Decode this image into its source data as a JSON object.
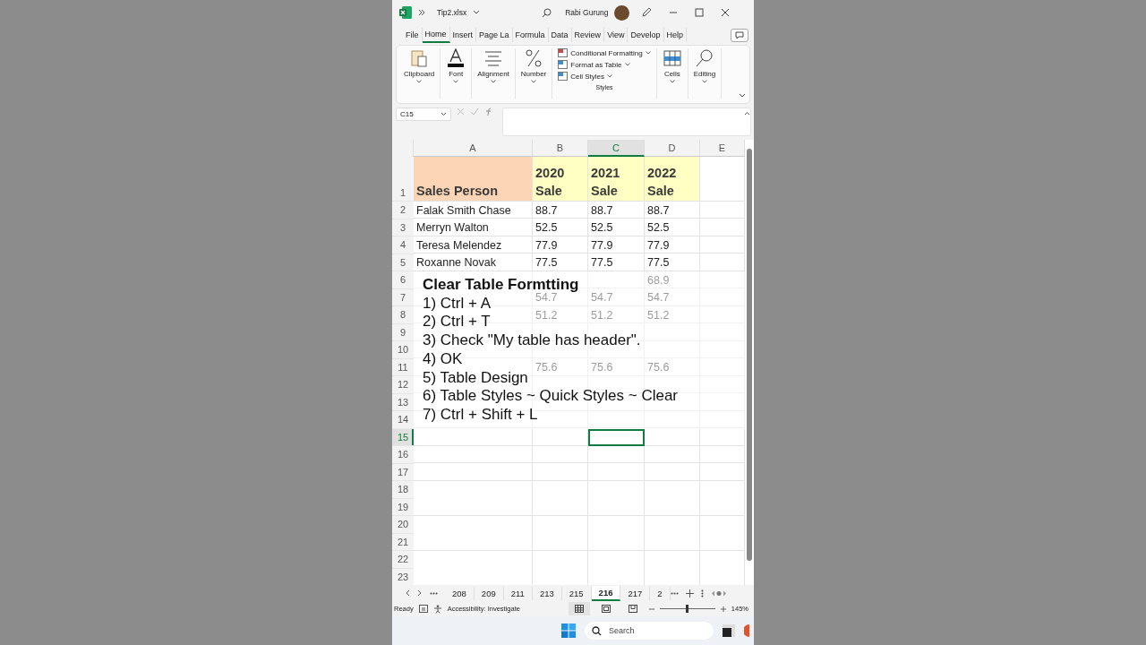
{
  "title_bar": {
    "file": "Tip2.xlsx",
    "user": "Rabi Gurung"
  },
  "menu_tabs": [
    {
      "label": "File",
      "selected": false
    },
    {
      "label": "Home",
      "selected": true
    },
    {
      "label": "Insert",
      "selected": false
    },
    {
      "label": "Page La",
      "selected": false
    },
    {
      "label": "Formula",
      "selected": false
    },
    {
      "label": "Data",
      "selected": false
    },
    {
      "label": "Review",
      "selected": false
    },
    {
      "label": "View",
      "selected": false
    },
    {
      "label": "Develop",
      "selected": false
    },
    {
      "label": "Help",
      "selected": false
    }
  ],
  "ribbon": {
    "left_groups": [
      {
        "label": "Clipboard",
        "kind": "clipboard"
      },
      {
        "label": "Font",
        "kind": "font"
      },
      {
        "label": "Alignment",
        "kind": "alignment"
      },
      {
        "label": "Number",
        "kind": "number"
      }
    ],
    "styles": {
      "items": [
        "Conditional Formatting",
        "Format as Table",
        "Cell Styles"
      ],
      "label": "Styles"
    },
    "right_groups": [
      {
        "label": "Cells",
        "kind": "cells"
      },
      {
        "label": "Editing",
        "kind": "editing"
      }
    ]
  },
  "name_box": "C15",
  "columns": [
    {
      "label": "A",
      "selected": false
    },
    {
      "label": "B",
      "selected": false
    },
    {
      "label": "C",
      "selected": true
    },
    {
      "label": "D",
      "selected": false
    },
    {
      "label": "E",
      "selected": false
    }
  ],
  "header_row": {
    "num": "1",
    "cells": [
      [
        "Sales Person"
      ],
      [
        "2020",
        "Sale"
      ],
      [
        "2021",
        "Sale"
      ],
      [
        "2022",
        "Sale"
      ]
    ]
  },
  "rows": [
    {
      "num": "2",
      "cells": {
        "A": "Falak Smith Chase",
        "B": "88.7",
        "C": "88.7",
        "D": "88.7"
      },
      "selected": false
    },
    {
      "num": "3",
      "cells": {
        "A": "Merryn Walton",
        "B": "52.5",
        "C": "52.5",
        "D": "52.5"
      },
      "selected": false
    },
    {
      "num": "4",
      "cells": {
        "A": "Teresa Melendez",
        "B": "77.9",
        "C": "77.9",
        "D": "77.9"
      },
      "selected": false
    },
    {
      "num": "5",
      "cells": {
        "A": "Roxanne Novak",
        "B": "77.5",
        "C": "77.5",
        "D": "77.5"
      },
      "selected": false
    },
    {
      "num": "6",
      "cells": {
        "D": "68.9"
      },
      "selected": false
    },
    {
      "num": "7",
      "cells": {
        "B": "54.7",
        "C": "54.7",
        "D": "54.7"
      },
      "selected": false
    },
    {
      "num": "8",
      "cells": {
        "B": "51.2",
        "C": "51.2",
        "D": "51.2"
      },
      "selected": false
    },
    {
      "num": "9",
      "cells": {},
      "selected": false
    },
    {
      "num": "10",
      "cells": {},
      "selected": false
    },
    {
      "num": "11",
      "cells": {
        "B": "75.6",
        "C": "75.6",
        "D": "75.6"
      },
      "selected": false
    },
    {
      "num": "12",
      "cells": {},
      "selected": false
    },
    {
      "num": "13",
      "cells": {},
      "selected": false
    },
    {
      "num": "14",
      "cells": {},
      "selected": false
    },
    {
      "num": "15",
      "cells": {},
      "selected": true
    },
    {
      "num": "16",
      "cells": {},
      "selected": false
    },
    {
      "num": "17",
      "cells": {},
      "selected": false
    },
    {
      "num": "18",
      "cells": {},
      "selected": false
    },
    {
      "num": "19",
      "cells": {},
      "selected": false
    },
    {
      "num": "20",
      "cells": {},
      "selected": false
    },
    {
      "num": "21",
      "cells": {},
      "selected": false
    },
    {
      "num": "22",
      "cells": {},
      "selected": false
    },
    {
      "num": "23",
      "cells": {},
      "selected": false
    }
  ],
  "overlay": {
    "title": "Clear Table Formtting",
    "steps": [
      "1) Ctrl + A",
      "2) Ctrl + T",
      "3) Check \"My table has header\".",
      "4) OK",
      "5) Table Design",
      "6) Table Styles ~ Quick Styles ~ Clear",
      "7) Ctrl + Shift + L"
    ]
  },
  "sheet_tabs": [
    {
      "label": "208",
      "selected": false
    },
    {
      "label": "209",
      "selected": false
    },
    {
      "label": "211",
      "selected": false
    },
    {
      "label": "213",
      "selected": false
    },
    {
      "label": "215",
      "selected": false
    },
    {
      "label": "216",
      "selected": true
    },
    {
      "label": "217",
      "selected": false
    },
    {
      "label": "2",
      "selected": false
    }
  ],
  "status_bar": {
    "mode": "Ready",
    "accessibility": "Accessibility: Investigate",
    "zoom": "145%",
    "zoom_slider": {
      "level": 0.5
    }
  },
  "taskbar": {
    "search_placeholder": "Search"
  }
}
